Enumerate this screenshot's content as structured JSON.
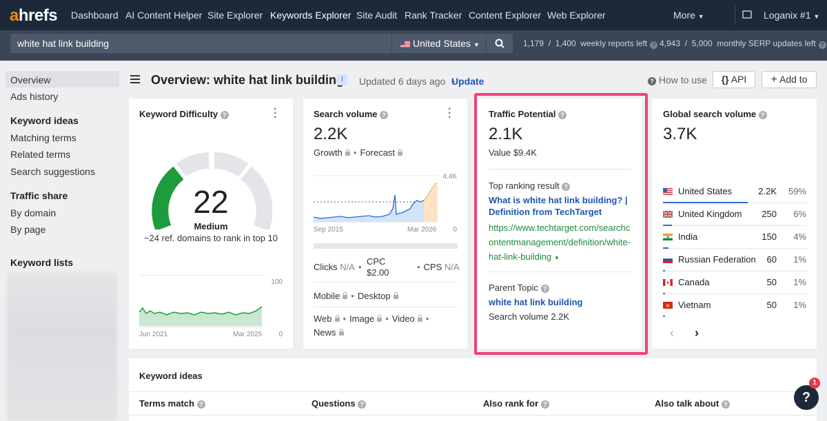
{
  "nav": {
    "logo_a": "a",
    "logo_rest": "hrefs",
    "items": [
      "Dashboard",
      "AI Content Helper",
      "Site Explorer",
      "Keywords Explorer",
      "Site Audit",
      "Rank Tracker",
      "Content Explorer",
      "Web Explorer"
    ],
    "more": "More",
    "account": "Loganix #1"
  },
  "search": {
    "query": "white hat link building",
    "country": "United States",
    "weekly_used": "1,179",
    "weekly_total": "1,400",
    "weekly_label": "weekly reports left",
    "serp_used": "4,943",
    "serp_total": "5,000",
    "serp_label": "monthly SERP updates left"
  },
  "sidebar": {
    "overview": "Overview",
    "ads_history": "Ads history",
    "keyword_ideas_head": "Keyword ideas",
    "matching_terms": "Matching terms",
    "related_terms": "Related terms",
    "search_suggestions": "Search suggestions",
    "traffic_share_head": "Traffic share",
    "by_domain": "By domain",
    "by_page": "By page",
    "keyword_lists_head": "Keyword lists"
  },
  "header": {
    "title": "Overview: white hat link building",
    "badge": "I",
    "updated": "Updated 6 days ago",
    "update_link": "Update",
    "how_to_use": "How to use",
    "api": "API",
    "add_to": "Add to"
  },
  "kd": {
    "title": "Keyword Difficulty",
    "value": "22",
    "level": "Medium",
    "note": "~24 ref. domains to rank in top 10",
    "chart_max": "100",
    "chart_min": "0",
    "x_start": "Jun 2021",
    "x_end": "Mar 2025"
  },
  "sv": {
    "title": "Search volume",
    "value": "2.2K",
    "growth": "Growth",
    "forecast": "Forecast",
    "chart_max": "4.4K",
    "chart_min": "0",
    "x_start": "Sep 2015",
    "x_end": "Mar 2026",
    "clicks": "Clicks",
    "clicks_val": "N/A",
    "cpc": "CPC",
    "cpc_val": "$2.00",
    "cps": "CPS",
    "cps_val": "N/A",
    "mobile": "Mobile",
    "desktop": "Desktop",
    "web": "Web",
    "image": "Image",
    "video": "Video",
    "news": "News"
  },
  "tp": {
    "title": "Traffic Potential",
    "value": "2.1K",
    "value_label": "Value $9.4K",
    "top_result_label": "Top ranking result",
    "top_result_title_1": "What is white hat link building? |",
    "top_result_title_2": "Definition from TechTarget",
    "url_1": "https://www.techtarget.com/searchc",
    "url_2": "ontentmanagement/definition/white-",
    "url_3": "hat-link-building",
    "parent_label": "Parent Topic",
    "parent_topic": "white hat link building",
    "parent_volume": "Search volume 2.2K"
  },
  "gsv": {
    "title": "Global search volume",
    "value": "3.7K",
    "countries": [
      {
        "name": "United States",
        "value": "2.2K",
        "pct": "59%"
      },
      {
        "name": "United Kingdom",
        "value": "250",
        "pct": "6%"
      },
      {
        "name": "India",
        "value": "150",
        "pct": "4%"
      },
      {
        "name": "Russian Federation",
        "value": "60",
        "pct": "1%"
      },
      {
        "name": "Canada",
        "value": "50",
        "pct": "1%"
      },
      {
        "name": "Vietnam",
        "value": "50",
        "pct": "1%"
      }
    ]
  },
  "ideas": {
    "title": "Keyword ideas",
    "cols": [
      "Terms match",
      "Questions",
      "Also rank for",
      "Also talk about"
    ]
  },
  "help": {
    "label": "?",
    "badge": "1"
  },
  "colors": {
    "nav_bg": "#1d2939",
    "accent": "#ff8800",
    "highlight": "#f0407b",
    "link": "#1e55b4",
    "url_green": "#1e8a3c"
  }
}
